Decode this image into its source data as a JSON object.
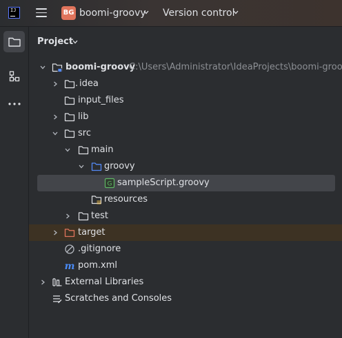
{
  "titlebar": {
    "project_badge": "BG",
    "project_name": "boomi-groovy",
    "vcs_label": "Version control"
  },
  "panel": {
    "title": "Project"
  },
  "tree": {
    "root": {
      "label": "boomi-groovy",
      "path": "C:\\Users\\Administrator\\IdeaProjects\\boomi-groovy"
    },
    "idea": "idea",
    "input_files": "input_files",
    "lib": "lib",
    "src": "src",
    "main": "main",
    "groovy": "groovy",
    "sample_script": "sampleScript.groovy",
    "resources": "resources",
    "test": "test",
    "target": "target",
    "gitignore": ".gitignore",
    "pom": "pom.xml",
    "external_libraries": "External Libraries",
    "scratches": "Scratches and Consoles"
  },
  "colors": {
    "background": "#2b2d30",
    "selection": "#43454a",
    "excluded_row": "#3d3223",
    "folder_blue": "#548af7",
    "folder_orange": "#e0745c",
    "groovy_green": "#5fb865",
    "maven_blue": "#4a8bf5",
    "project_badge": "#e0745c"
  },
  "icons": {
    "logo": "intellij-logo-icon",
    "menu": "hamburger-menu-icon",
    "project_tool": "folder-icon",
    "structure_tool": "structure-icon",
    "more_tools": "more-dots-icon"
  }
}
